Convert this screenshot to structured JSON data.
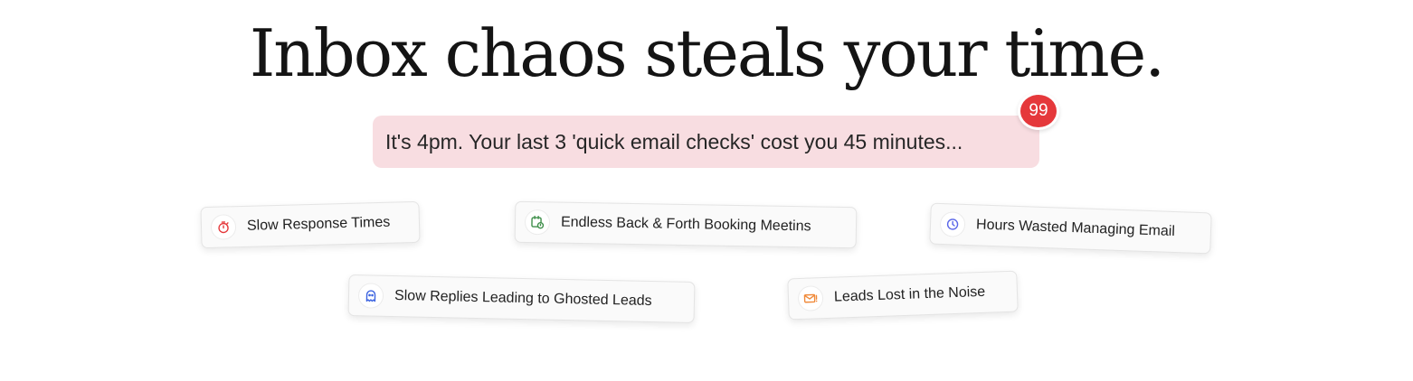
{
  "headline": "Inbox chaos steals your time.",
  "callout": {
    "text": "It's 4pm. Your last 3 'quick email checks' cost you 45 minutes...",
    "badge": "99"
  },
  "pain_points": [
    {
      "label": "Slow Response Times",
      "icon": "stopwatch-icon",
      "color": "#e5383b"
    },
    {
      "label": "Endless Back & Forth Booking Meetins",
      "icon": "calendar-clock-icon",
      "color": "#3f8f4a"
    },
    {
      "label": "Hours Wasted Managing Email",
      "icon": "clock-icon",
      "color": "#5a66e8"
    },
    {
      "label": "Slow Replies Leading to Ghosted Leads",
      "icon": "ghost-icon",
      "color": "#3b63e0"
    },
    {
      "label": "Leads Lost in the Noise",
      "icon": "mail-alert-icon",
      "color": "#f08a3a"
    }
  ],
  "colors": {
    "callout_bg": "#f8dde1",
    "badge_bg": "#e5383b",
    "headline": "#141414"
  }
}
